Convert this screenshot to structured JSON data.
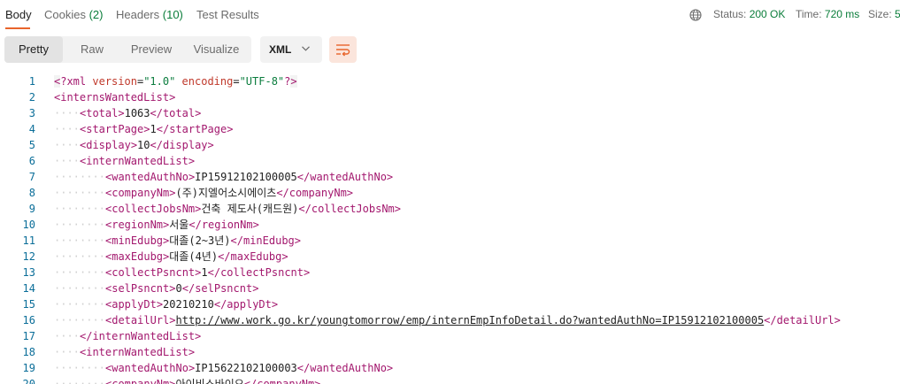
{
  "tabs": [
    {
      "label": "Body",
      "count": ""
    },
    {
      "label": "Cookies",
      "count": "(2)"
    },
    {
      "label": "Headers",
      "count": "(10)"
    },
    {
      "label": "Test Results",
      "count": ""
    }
  ],
  "status": {
    "label": "Status:",
    "value": "200 OK"
  },
  "time": {
    "label": "Time:",
    "value": "720 ms"
  },
  "size": {
    "label": "Size:",
    "value": "5"
  },
  "view_modes": [
    "Pretty",
    "Raw",
    "Preview",
    "Visualize"
  ],
  "format": "XML",
  "icons": {
    "globe": "globe-icon",
    "chevron": "chevron-down-icon",
    "wrap": "wrap-lines-icon"
  },
  "colors": {
    "accent": "#e8642b",
    "success": "#0a7d3a",
    "tag": "#a3186e",
    "attr_name": "#c0392b",
    "attr_value": "#0b7d3e",
    "line_number": "#0b6e99"
  },
  "code_lines": [
    {
      "n": "1",
      "indent": 0,
      "kind": "pi",
      "decl": "?xml",
      "attrs": [
        {
          "name": "version",
          "value": "\"1.0\""
        },
        {
          "name": "encoding",
          "value": "\"UTF-8\""
        }
      ]
    },
    {
      "n": "2",
      "indent": 0,
      "kind": "open",
      "tag": "internsWantedList"
    },
    {
      "n": "3",
      "indent": 1,
      "kind": "elem",
      "tag": "total",
      "text": "1063"
    },
    {
      "n": "4",
      "indent": 1,
      "kind": "elem",
      "tag": "startPage",
      "text": "1"
    },
    {
      "n": "5",
      "indent": 1,
      "kind": "elem",
      "tag": "display",
      "text": "10"
    },
    {
      "n": "6",
      "indent": 1,
      "kind": "open",
      "tag": "internWantedList"
    },
    {
      "n": "7",
      "indent": 2,
      "kind": "elem",
      "tag": "wantedAuthNo",
      "text": "IP15912102100005"
    },
    {
      "n": "8",
      "indent": 2,
      "kind": "elem",
      "tag": "companyNm",
      "text": "(주)지엘어소시에이츠"
    },
    {
      "n": "9",
      "indent": 2,
      "kind": "elem",
      "tag": "collectJobsNm",
      "text": "건축 제도사(캐드원)"
    },
    {
      "n": "10",
      "indent": 2,
      "kind": "elem",
      "tag": "regionNm",
      "text": "서울"
    },
    {
      "n": "11",
      "indent": 2,
      "kind": "elem",
      "tag": "minEdubg",
      "text": "대졸(2~3년)"
    },
    {
      "n": "12",
      "indent": 2,
      "kind": "elem",
      "tag": "maxEdubg",
      "text": "대졸(4년)"
    },
    {
      "n": "13",
      "indent": 2,
      "kind": "elem",
      "tag": "collectPsncnt",
      "text": "1"
    },
    {
      "n": "14",
      "indent": 2,
      "kind": "elem",
      "tag": "selPsncnt",
      "text": "0"
    },
    {
      "n": "15",
      "indent": 2,
      "kind": "elem",
      "tag": "applyDt",
      "text": "20210210"
    },
    {
      "n": "16",
      "indent": 2,
      "kind": "elem",
      "tag": "detailUrl",
      "text": "http://www.work.go.kr/youngtomorrow/emp/internEmpInfoDetail.do?wantedAuthNo=IP15912102100005",
      "link": true
    },
    {
      "n": "17",
      "indent": 1,
      "kind": "close",
      "tag": "internWantedList"
    },
    {
      "n": "18",
      "indent": 1,
      "kind": "open",
      "tag": "internWantedList"
    },
    {
      "n": "19",
      "indent": 2,
      "kind": "elem",
      "tag": "wantedAuthNo",
      "text": "IP15622102100003"
    },
    {
      "n": "20",
      "indent": 2,
      "kind": "elem",
      "tag": "companyNm",
      "text": "아이비스바이오"
    }
  ]
}
